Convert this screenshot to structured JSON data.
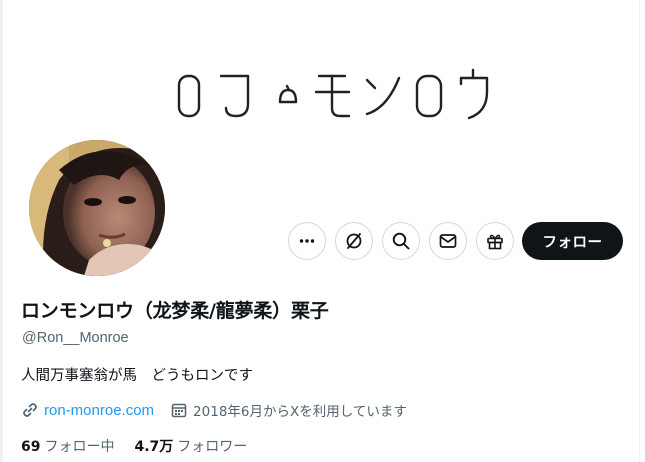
{
  "profile": {
    "display_name": "ロンモンロウ（龙梦柔/龍夢柔）栗子",
    "handle": "@Ron__Monroe",
    "bio": "人間万事塞翁が馬　どうもロンです",
    "website": "ron-monroe.com",
    "joined": "2018年6月からXを利用しています"
  },
  "stats": {
    "following_count": "69",
    "following_label": "フォロー中",
    "followers_count": "4.7万",
    "followers_label": "フォロワー"
  },
  "actions": {
    "follow_label": "フォロー",
    "buttons": [
      "more-icon",
      "grok-icon",
      "search-icon",
      "message-icon",
      "subscribe-gift-icon"
    ]
  },
  "banner": {
    "logo_icon": "ron-monroe-logo-icon"
  },
  "colors": {
    "text": "#0f1419",
    "secondary": "#536471",
    "link": "#1d9bf0",
    "button_dark": "#0f1419",
    "border": "#cfd9de"
  }
}
